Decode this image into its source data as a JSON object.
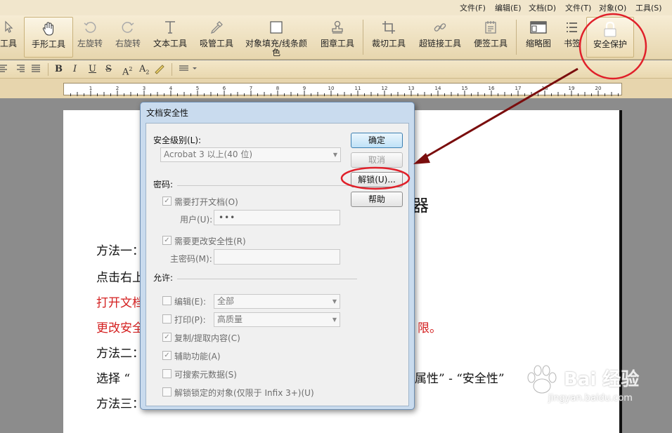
{
  "menubar": {
    "items": [
      "文件(F)",
      "编辑(E)",
      "文档(D)",
      "文件(T)",
      "对象(O)",
      "工具(S)"
    ]
  },
  "toolbar": {
    "tools": [
      {
        "label": "工具",
        "icon": "pointer-icon"
      },
      {
        "label": "手形工具",
        "icon": "hand-icon"
      },
      {
        "label": "左旋转",
        "icon": "rotate-left-icon"
      },
      {
        "label": "右旋转",
        "icon": "rotate-right-icon"
      },
      {
        "label": "文本工具",
        "icon": "text-tool-icon"
      },
      {
        "label": "吸管工具",
        "icon": "eyedropper-icon"
      },
      {
        "label": "对象填充/线条颜色",
        "icon": "fill-color-icon"
      },
      {
        "label": "图章工具",
        "icon": "stamp-icon"
      },
      {
        "label": "裁切工具",
        "icon": "crop-icon"
      },
      {
        "label": "超链接工具",
        "icon": "link-icon"
      },
      {
        "label": "便签工具",
        "icon": "note-icon"
      },
      {
        "label": "缩略图",
        "icon": "thumbnail-icon"
      },
      {
        "label": "书签",
        "icon": "bookmark-icon"
      },
      {
        "label": "安全保护",
        "icon": "lock-icon"
      }
    ]
  },
  "formatbar": {
    "bold": "B",
    "italic": "I",
    "underline": "U",
    "strike": "S",
    "superscript": "A",
    "subscript": "A"
  },
  "ruler": {
    "labels": [
      "1",
      "2",
      "3",
      "4",
      "5",
      "6",
      "7",
      "8",
      "9",
      "10",
      "11",
      "12",
      "13",
      "14",
      "15",
      "16",
      "17",
      "18",
      "19",
      "20"
    ]
  },
  "document": {
    "heading_fragment": "器",
    "lines": [
      {
        "text": "方法一：",
        "color": "normal"
      },
      {
        "text": "点击右上",
        "color": "normal"
      },
      {
        "text": "打开文档",
        "color": "red"
      },
      {
        "text": "更改安全",
        "color": "red"
      },
      {
        "text": "方法二：",
        "color": "normal"
      },
      {
        "text": "选择 “",
        "color": "normal"
      },
      {
        "text": "方法三：",
        "color": "normal"
      }
    ],
    "right_fragments": {
      "line4": "限。",
      "line6": "属性” - “安全性”"
    }
  },
  "dialog": {
    "title": "文档安全性",
    "security_level_label": "安全级别(L):",
    "security_level_value": "Acrobat 3 以上(40 位)",
    "password_group": "密码:",
    "require_open_label": "需要打开文档(O)",
    "user_label": "用户(U):",
    "user_value": "•••",
    "require_change_label": "需要更改安全性(R)",
    "master_label": "主密码(M):",
    "master_value": "",
    "permissions_group": "允许:",
    "edit_label": "编辑(E):",
    "edit_value": "全部",
    "print_label": "打印(P):",
    "print_value": "高质量",
    "copy_label": "复制/提取内容(C)",
    "access_label": "辅助功能(A)",
    "search_meta_label": "可搜索元数据(S)",
    "unlock_objects_label": "解锁锁定的对象(仅限于 Infix 3+)(U)",
    "buttons": {
      "ok": "确定",
      "cancel": "取消",
      "unlock": "解锁(U)...",
      "help": "帮助"
    }
  },
  "watermark": {
    "brand": "Bai 经验",
    "url": "jingyan.baidu.com"
  },
  "colors": {
    "annotation_red": "#e0202a",
    "arrow_dark_red": "#7a0d0d",
    "document_red": "#d42020"
  }
}
